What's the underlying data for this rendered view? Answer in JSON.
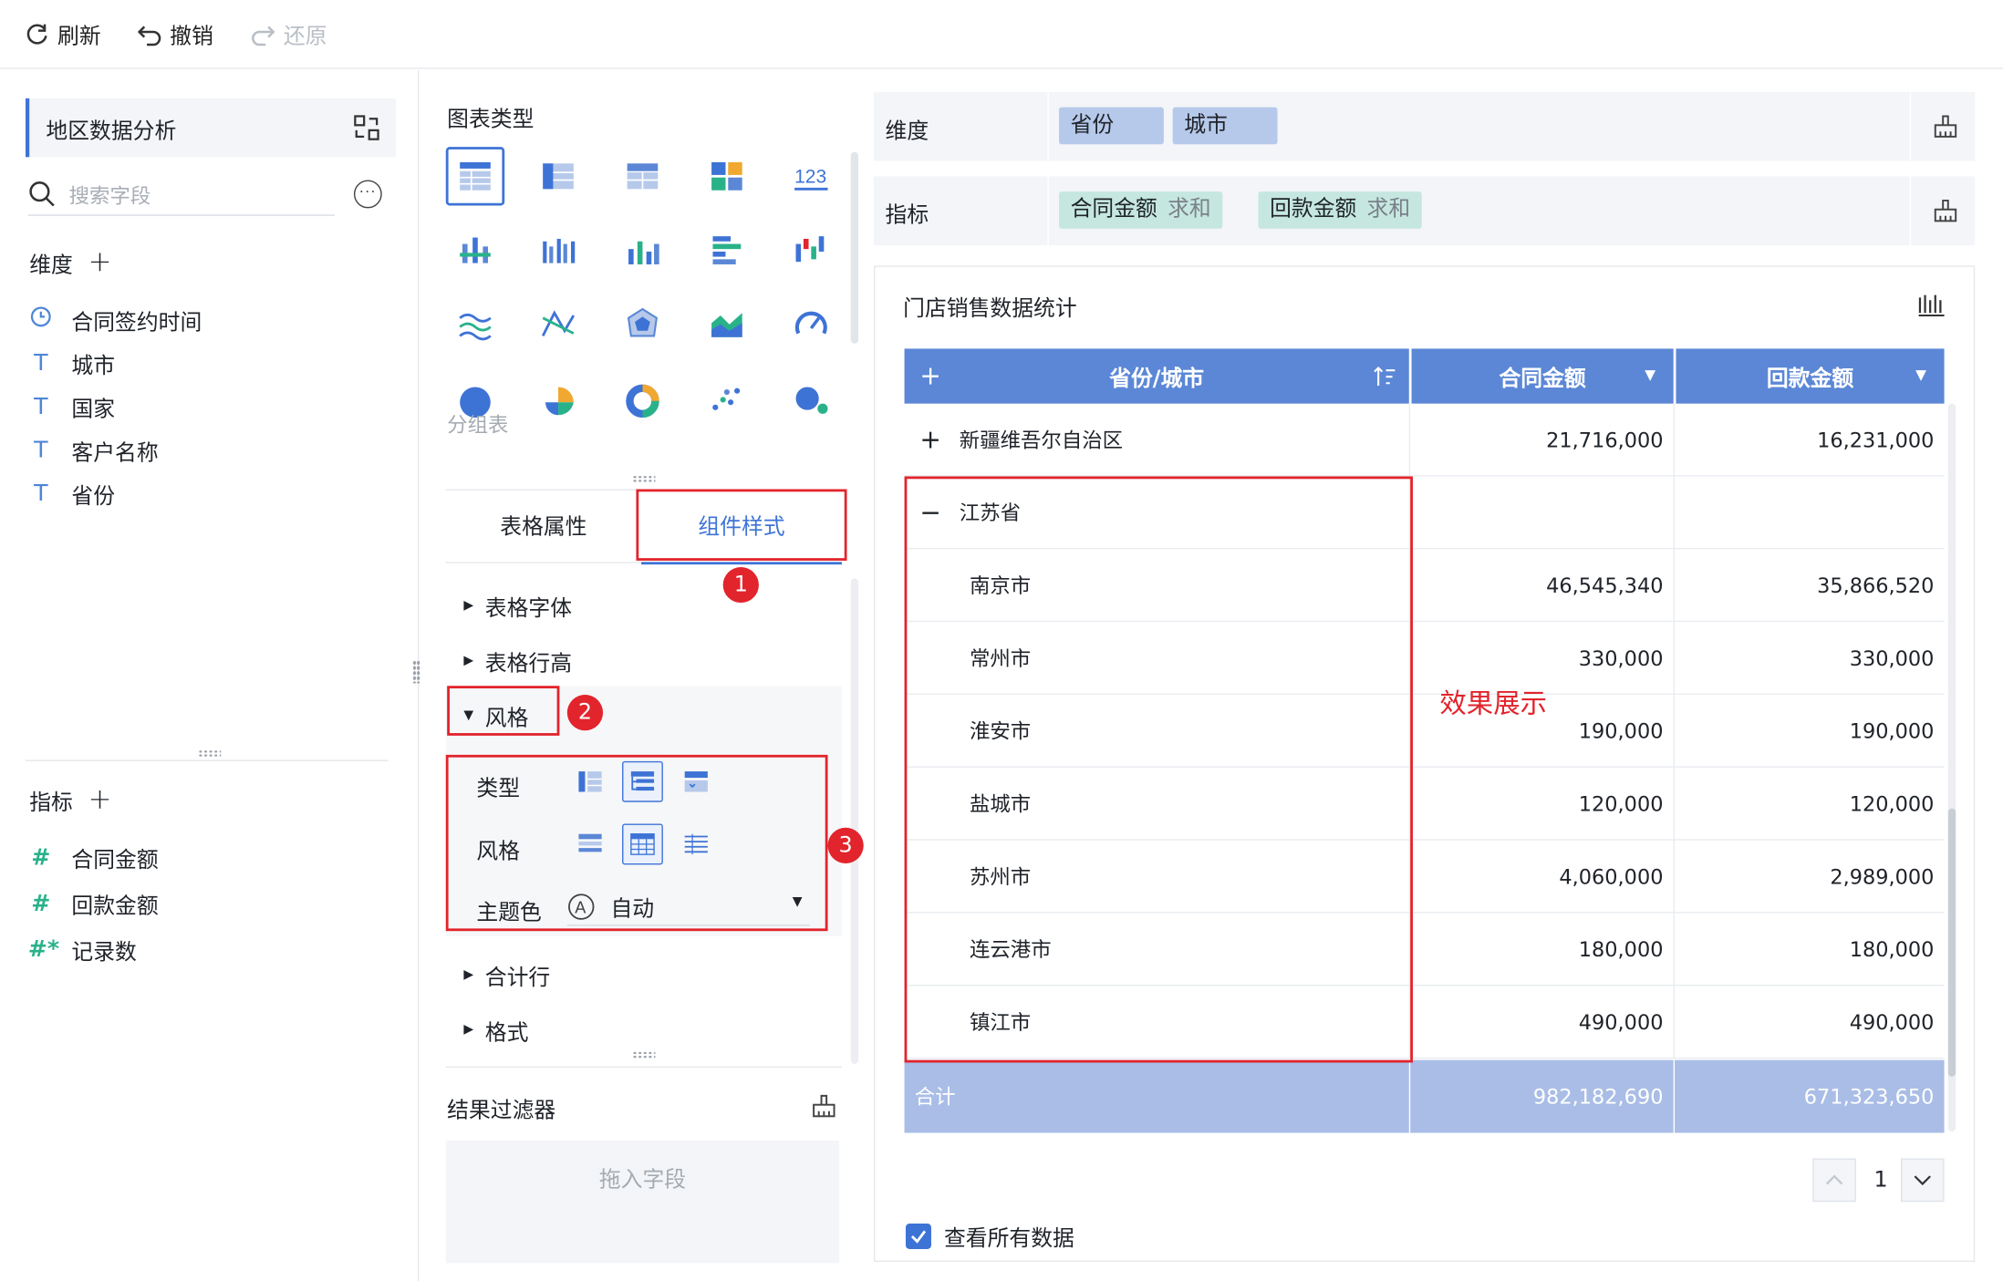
{
  "toolbar": {
    "refresh": "刷新",
    "undo": "撤销",
    "redo": "还原"
  },
  "left": {
    "dataset_name": "地区数据分析",
    "search_placeholder": "搜索字段",
    "dimension_title": "维度",
    "dimension_fields": [
      {
        "label": "合同签约时间",
        "icon": "clock-icon"
      },
      {
        "label": "城市",
        "icon": "text-type-icon"
      },
      {
        "label": "国家",
        "icon": "text-type-icon"
      },
      {
        "label": "客户名称",
        "icon": "text-type-icon"
      },
      {
        "label": "省份",
        "icon": "text-type-icon"
      }
    ],
    "metric_title": "指标",
    "metric_fields": [
      {
        "label": "合同金额",
        "icon": "hash-icon"
      },
      {
        "label": "回款金额",
        "icon": "hash-icon"
      },
      {
        "label": "记录数",
        "icon": "hash-star-icon"
      }
    ]
  },
  "middle": {
    "chart_type_title": "图表类型",
    "chart_type_hover_label": "分组表",
    "tabs": [
      "表格属性",
      "组件样式"
    ],
    "active_tab": "组件样式",
    "sections": [
      "表格字体",
      "表格行高",
      "风格",
      "合计行",
      "格式"
    ],
    "style_rows": {
      "type_label": "类型",
      "style_label": "风格",
      "theme_label": "主题色",
      "theme_value": "自动"
    },
    "filter_title": "结果过滤器",
    "drop_hint": "拖入字段"
  },
  "annotations": {
    "badge1": "1",
    "badge2": "2",
    "badge3": "3",
    "effect_label": "效果展示"
  },
  "right": {
    "dimension_label": "维度",
    "dimension_pills": [
      "省份",
      "城市"
    ],
    "metric_label": "指标",
    "metric_pills": [
      {
        "name": "合同金额",
        "agg": "求和"
      },
      {
        "name": "回款金额",
        "agg": "求和"
      }
    ],
    "component_title": "门店销售数据统计",
    "table": {
      "headers": [
        "省份/城市",
        "合同金额",
        "回款金额"
      ],
      "header_plus": "+",
      "rows": [
        {
          "toggle": "+",
          "name": "新疆维吾尔自治区",
          "contract": "21,716,000",
          "payment": "16,231,000",
          "level": 0
        },
        {
          "toggle": "−",
          "name": "江苏省",
          "contract": "",
          "payment": "",
          "level": 0
        },
        {
          "toggle": "",
          "name": "南京市",
          "contract": "46,545,340",
          "payment": "35,866,520",
          "level": 1
        },
        {
          "toggle": "",
          "name": "常州市",
          "contract": "330,000",
          "payment": "330,000",
          "level": 1
        },
        {
          "toggle": "",
          "name": "淮安市",
          "contract": "190,000",
          "payment": "190,000",
          "level": 1
        },
        {
          "toggle": "",
          "name": "盐城市",
          "contract": "120,000",
          "payment": "120,000",
          "level": 1
        },
        {
          "toggle": "",
          "name": "苏州市",
          "contract": "4,060,000",
          "payment": "2,989,000",
          "level": 1
        },
        {
          "toggle": "",
          "name": "连云港市",
          "contract": "180,000",
          "payment": "180,000",
          "level": 1
        },
        {
          "toggle": "",
          "name": "镇江市",
          "contract": "490,000",
          "payment": "490,000",
          "level": 1
        }
      ],
      "total": {
        "label": "合计",
        "contract": "982,182,690",
        "payment": "671,323,650"
      }
    },
    "page_number": "1",
    "view_all_label": "查看所有数据"
  },
  "colors": {
    "accent": "#3e73d6",
    "header": "#5b87d6",
    "total_row": "#a9bde6",
    "annotation_red": "#e2242c"
  }
}
